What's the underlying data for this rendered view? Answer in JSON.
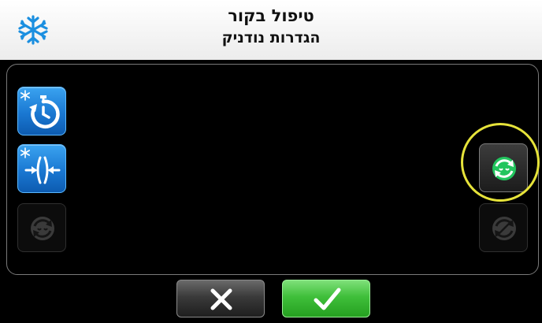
{
  "header": {
    "title": "טיפול בקור",
    "subtitle": "הגדרות נודניק",
    "icon": "snowflake-icon"
  },
  "left_column": [
    {
      "name": "snow-timer-button",
      "icon": "snowflake-timer-icon",
      "state": "enabled"
    },
    {
      "name": "snow-compress-button",
      "icon": "snowflake-compress-icon",
      "state": "enabled"
    },
    {
      "name": "snooze-disabled-button",
      "icon": "snooze-cycle-icon",
      "state": "disabled"
    }
  ],
  "right_column": [
    {
      "name": "snooze-active-button",
      "icon": "green-snooze-cycle-icon",
      "state": "highlighted"
    },
    {
      "name": "snooze-off-button",
      "icon": "snooze-cycle-icon",
      "state": "disabled"
    }
  ],
  "footer": {
    "cancel_icon": "x-icon",
    "confirm_icon": "checkmark-icon"
  },
  "colors": {
    "tile_blue": "#1a78d2",
    "highlight": "#e6e33a",
    "confirm_green": "#3fbf3a",
    "active_icon_green": "#22c55e"
  }
}
